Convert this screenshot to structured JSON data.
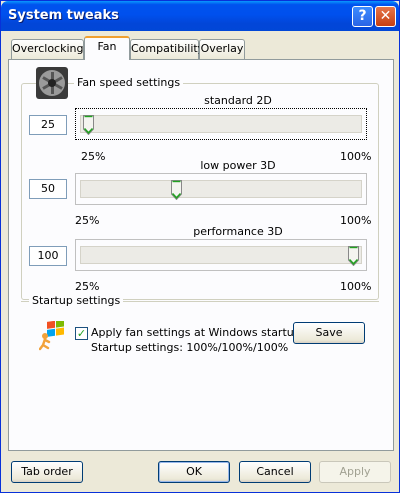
{
  "window": {
    "title": "System tweaks"
  },
  "titlebar": {
    "help_glyph": "?",
    "close_glyph": "✕"
  },
  "tabs": [
    {
      "label": "Overclocking",
      "active": false
    },
    {
      "label": "Fan",
      "active": true
    },
    {
      "label": "Compatibility",
      "active": false
    },
    {
      "label": "Overlay",
      "active": false
    }
  ],
  "fan": {
    "group_title": "Fan speed settings",
    "icon": "fan-icon",
    "sliders": [
      {
        "label": "standard 2D",
        "value": "25",
        "min_label": "25%",
        "max_label": "100%",
        "percent": 25
      },
      {
        "label": "low power 3D",
        "value": "50",
        "min_label": "25%",
        "max_label": "100%",
        "percent": 50
      },
      {
        "label": "performance 3D",
        "value": "100",
        "min_label": "25%",
        "max_label": "100%",
        "percent": 100
      }
    ]
  },
  "startup": {
    "group_title": "Startup settings",
    "icon": "startup-run-icon",
    "checkbox_label": "Apply fan settings at Windows startup",
    "checked": true,
    "status_text": "Startup settings: 100%/100%/100%",
    "save_label": "Save"
  },
  "footer": {
    "tab_order_label": "Tab order",
    "ok_label": "OK",
    "cancel_label": "Cancel",
    "apply_label": "Apply"
  },
  "colors": {
    "titlebar": "#0053ee",
    "face": "#ece9d8",
    "tab_highlight": "#f0a030",
    "thumb_green": "#21a121"
  }
}
